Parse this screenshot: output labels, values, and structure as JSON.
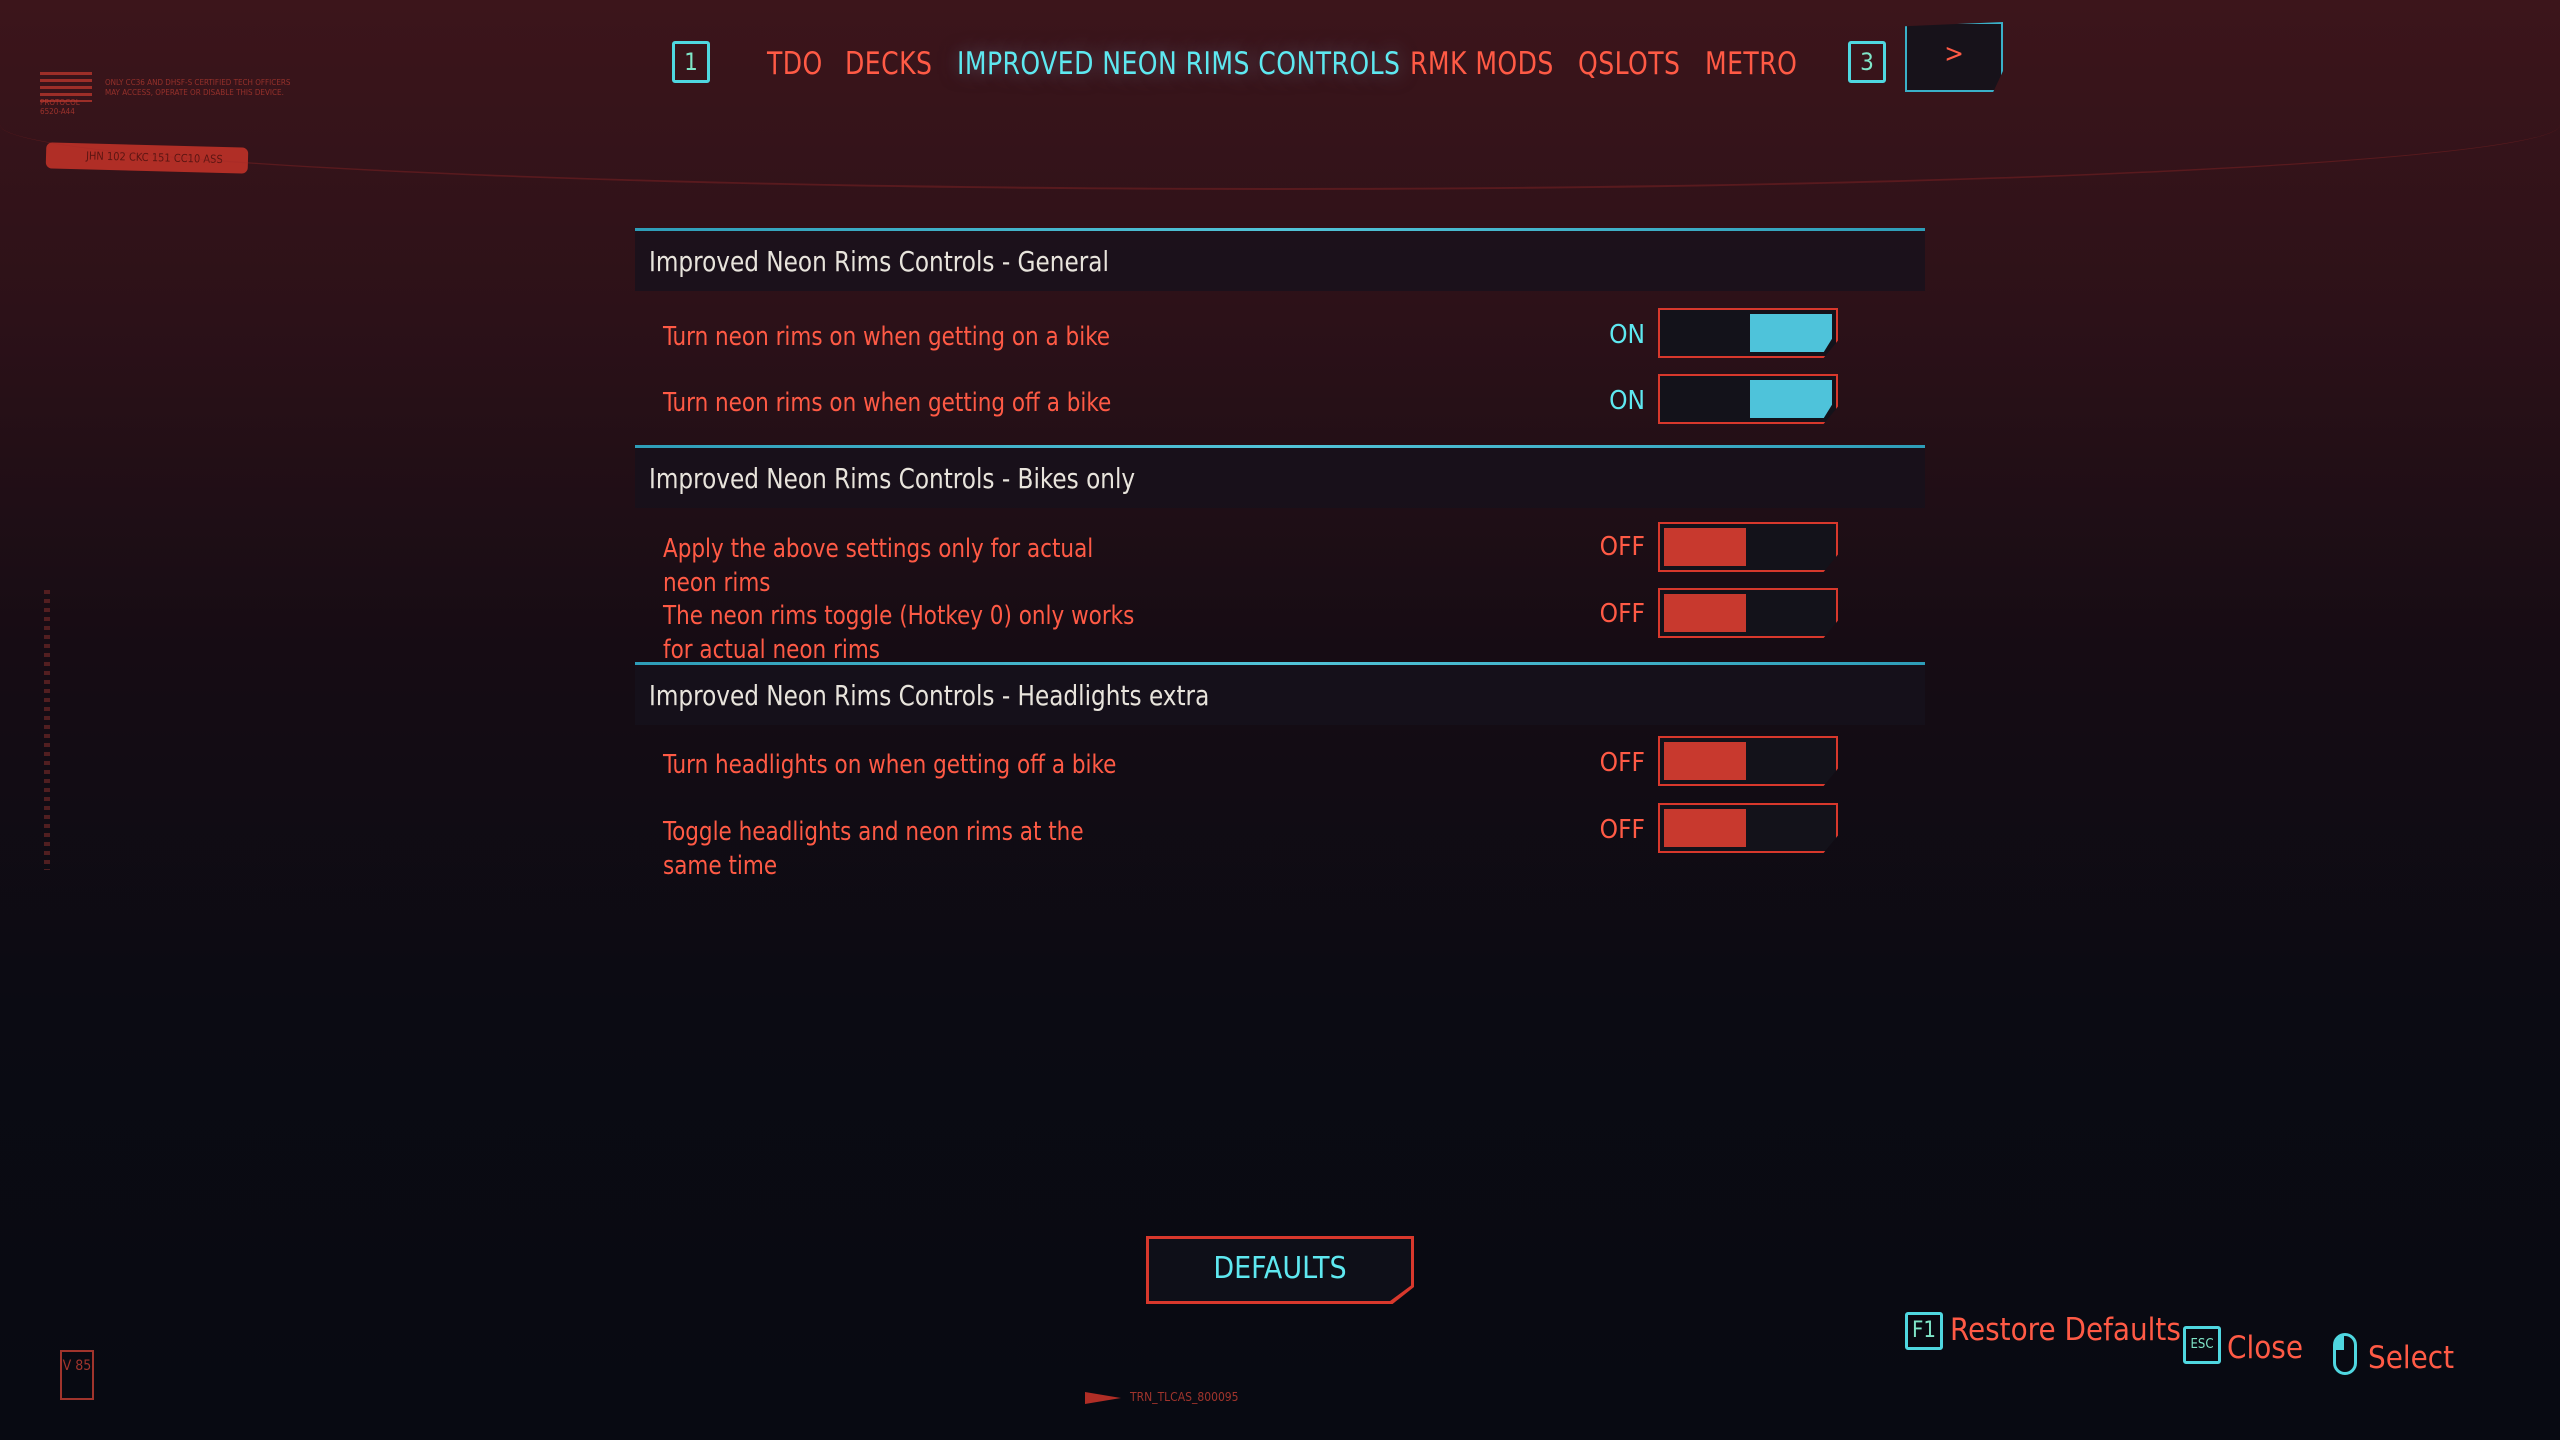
{
  "corner": {
    "protocol": "PROTOCOL 6520-A44",
    "notice": "ONLY CC36 AND DHSF-S CERTIFIED TECH OFFICERS MAY ACCESS, OPERATE OR DISABLE THIS DEVICE.",
    "plate": "JHN 102 CKC 151 CC10 ASS"
  },
  "nav": {
    "prev_key": "1",
    "next_key": "3",
    "more_label": ">",
    "tabs": [
      {
        "label": "TDO",
        "active": false
      },
      {
        "label": "DECKS",
        "active": false
      },
      {
        "label": "IMPROVED NEON RIMS CONTROLS",
        "active": true
      },
      {
        "label": "RMK MODS",
        "active": false
      },
      {
        "label": "QSLOTS",
        "active": false
      },
      {
        "label": "METRO",
        "active": false
      }
    ]
  },
  "sections": [
    {
      "title": "Improved Neon Rims Controls - General",
      "rows": [
        {
          "label": "Turn neon rims on when getting on a bike",
          "state": "ON"
        },
        {
          "label": "Turn neon rims on when getting off a bike",
          "state": "ON"
        }
      ]
    },
    {
      "title": "Improved Neon Rims Controls - Bikes only",
      "rows": [
        {
          "label": "Apply the above settings only for actual neon rims",
          "state": "OFF"
        },
        {
          "label": "The neon rims toggle (Hotkey 0) only works for actual neon rims",
          "state": "OFF"
        }
      ]
    },
    {
      "title": "Improved Neon Rims Controls - Headlights extra",
      "rows": [
        {
          "label": "Turn headlights on when getting off a bike",
          "state": "OFF"
        },
        {
          "label": "Toggle headlights and neon rims at the same time",
          "state": "OFF"
        }
      ]
    }
  ],
  "defaults_button": "DEFAULTS",
  "hints": {
    "restore_key": "F1",
    "restore_label": "Restore Defaults",
    "close_key": "ESC",
    "close_label": "Close",
    "select_label": "Select"
  },
  "footer": {
    "code": "TRN_TLCAS_800095",
    "version": "V 85"
  },
  "colors": {
    "accent_cyan": "#5ee8f0",
    "accent_red": "#ff5a45",
    "toggle_on": "#4ec3da",
    "toggle_off": "#c8392e"
  }
}
